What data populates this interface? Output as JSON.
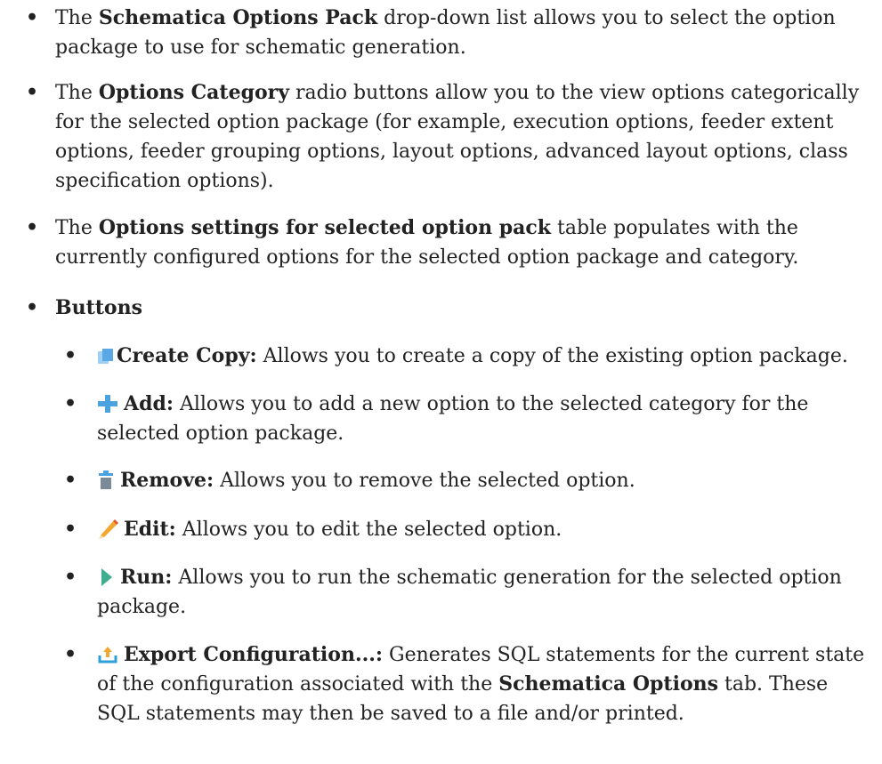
{
  "items": [
    {
      "pre": "The ",
      "bold": "Schematica Options Pack",
      "post": " drop-down list allows you to select the option package to use for schematic generation."
    },
    {
      "pre": "The ",
      "bold": "Options Category",
      "post": " radio buttons allow you to the view options categorically for the selected option package (for example, execution options, feeder extent options, feeder grouping options, layout options, advanced layout options, class specification options)."
    },
    {
      "pre": "The ",
      "bold": "Options settings for selected option pack",
      "post": " table populates with the currently configured options for the selected option package and category."
    }
  ],
  "buttons_heading": "Buttons",
  "buttons": [
    {
      "icon": "copy-icon",
      "label": "Create Copy:",
      "desc": " Allows you to create a copy of the existing option package."
    },
    {
      "icon": "add-icon",
      "label": "Add:",
      "desc": " Allows you to add a new option to the selected category for the selected option package."
    },
    {
      "icon": "trash-icon",
      "label": "Remove:",
      "desc": " Allows you to remove the selected option."
    },
    {
      "icon": "pencil-icon",
      "label": "Edit:",
      "desc": " Allows you to edit the selected option."
    },
    {
      "icon": "play-icon",
      "label": "Run:",
      "desc": " Allows you to run the schematic generation for the selected option package."
    },
    {
      "icon": "export-icon",
      "label": "Export Configuration...:",
      "desc": " Generates SQL statements for the current state of the configuration associated with the ",
      "desc_bold": "Schematica Options",
      "desc_post": " tab. These SQL statements may then be saved to a file and/or printed."
    }
  ],
  "colors": {
    "text": "#222222",
    "copy": "#5aa9e6",
    "add": "#4aa3df",
    "trash": "#7a8a96",
    "pencil": "#f0a830",
    "play": "#3fae8f",
    "export": "#2f9fd8"
  }
}
